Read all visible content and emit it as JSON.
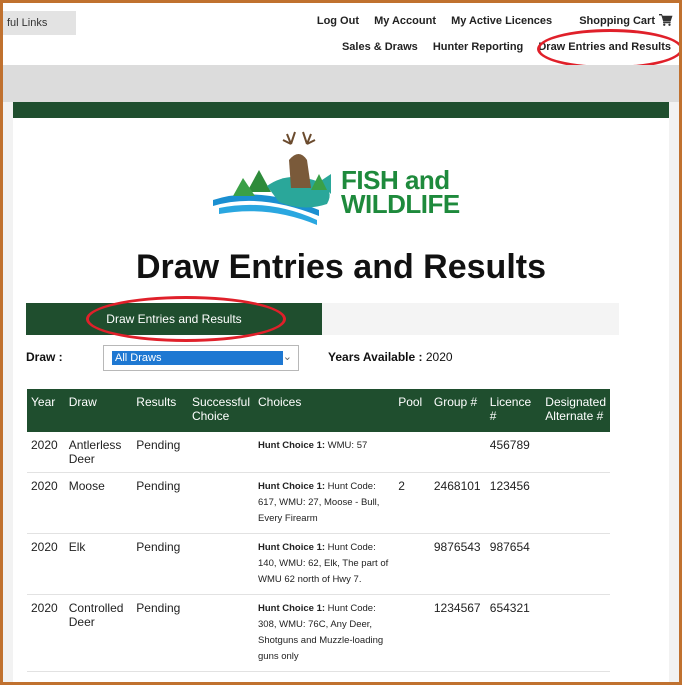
{
  "header": {
    "useful_links": "ful Links",
    "nav": [
      "Log Out",
      "My Account",
      "My Active Licences",
      "Shopping Cart"
    ],
    "subnav": [
      "Sales & Draws",
      "Hunter Reporting",
      "Draw Entries and Results"
    ]
  },
  "logo": {
    "line1": "FISH and",
    "line2": "WILDLIFE"
  },
  "page": {
    "title": "Draw Entries and Results"
  },
  "tabs": {
    "active": "Draw Entries and Results"
  },
  "filter": {
    "draw_label": "Draw :",
    "draw_selected": "All Draws",
    "years_label": "Years Available :",
    "years_value": "2020"
  },
  "table": {
    "headers": [
      "Year",
      "Draw",
      "Results",
      "Successful Choice",
      "Choices",
      "Pool",
      "Group #",
      "Licence #",
      "Designated Alternate #"
    ],
    "rows": [
      {
        "year": "2020",
        "draw": "Antlerless Deer",
        "result": "Pending",
        "successful_choice": "",
        "choice_label": "Hunt Choice 1:",
        "choice_text": "WMU: 57",
        "pool": "",
        "group": "",
        "licence": "456789",
        "alternate": ""
      },
      {
        "year": "2020",
        "draw": "Moose",
        "result": "Pending",
        "successful_choice": "",
        "choice_label": "Hunt Choice 1:",
        "choice_text": "Hunt Code: 617, WMU: 27, Moose - Bull, Every Firearm",
        "pool": "2",
        "group": "2468101",
        "licence": "123456",
        "alternate": ""
      },
      {
        "year": "2020",
        "draw": "Elk",
        "result": "Pending",
        "successful_choice": "",
        "choice_label": "Hunt Choice 1:",
        "choice_text": "Hunt Code: 140, WMU: 62, Elk, The part of WMU 62 north of Hwy 7.",
        "pool": "",
        "group": "9876543",
        "licence": "987654",
        "alternate": ""
      },
      {
        "year": "2020",
        "draw": "Controlled Deer",
        "result": "Pending",
        "successful_choice": "",
        "choice_label": "Hunt Choice 1:",
        "choice_text": "Hunt Code: 308, WMU: 76C, Any Deer, Shotguns and Muzzle-loading guns only",
        "pool": "",
        "group": "1234567",
        "licence": "654321",
        "alternate": ""
      }
    ]
  },
  "colors": {
    "brand_green": "#1f4e2e",
    "highlight_red": "#e0202a",
    "select_blue": "#1e78d2",
    "frame_orange": "#c0712f"
  },
  "icons": [
    "shopping-cart-icon",
    "chevron-down-icon",
    "fish-wildlife-logo"
  ]
}
